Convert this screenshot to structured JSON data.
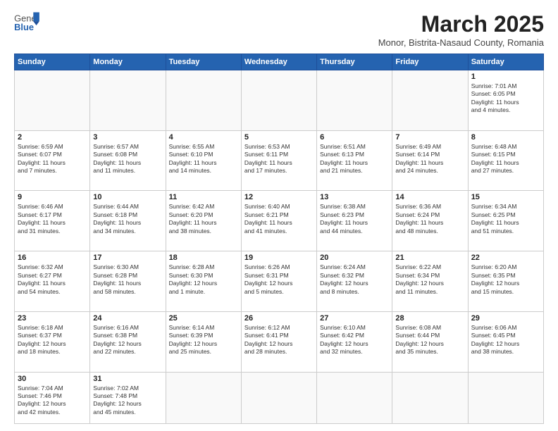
{
  "header": {
    "logo_general": "General",
    "logo_blue": "Blue",
    "month_title": "March 2025",
    "subtitle": "Monor, Bistrita-Nasaud County, Romania"
  },
  "weekdays": [
    "Sunday",
    "Monday",
    "Tuesday",
    "Wednesday",
    "Thursday",
    "Friday",
    "Saturday"
  ],
  "weeks": [
    [
      {
        "day": "",
        "info": ""
      },
      {
        "day": "",
        "info": ""
      },
      {
        "day": "",
        "info": ""
      },
      {
        "day": "",
        "info": ""
      },
      {
        "day": "",
        "info": ""
      },
      {
        "day": "",
        "info": ""
      },
      {
        "day": "1",
        "info": "Sunrise: 7:01 AM\nSunset: 6:05 PM\nDaylight: 11 hours\nand 4 minutes."
      }
    ],
    [
      {
        "day": "2",
        "info": "Sunrise: 6:59 AM\nSunset: 6:07 PM\nDaylight: 11 hours\nand 7 minutes."
      },
      {
        "day": "3",
        "info": "Sunrise: 6:57 AM\nSunset: 6:08 PM\nDaylight: 11 hours\nand 11 minutes."
      },
      {
        "day": "4",
        "info": "Sunrise: 6:55 AM\nSunset: 6:10 PM\nDaylight: 11 hours\nand 14 minutes."
      },
      {
        "day": "5",
        "info": "Sunrise: 6:53 AM\nSunset: 6:11 PM\nDaylight: 11 hours\nand 17 minutes."
      },
      {
        "day": "6",
        "info": "Sunrise: 6:51 AM\nSunset: 6:13 PM\nDaylight: 11 hours\nand 21 minutes."
      },
      {
        "day": "7",
        "info": "Sunrise: 6:49 AM\nSunset: 6:14 PM\nDaylight: 11 hours\nand 24 minutes."
      },
      {
        "day": "8",
        "info": "Sunrise: 6:48 AM\nSunset: 6:15 PM\nDaylight: 11 hours\nand 27 minutes."
      }
    ],
    [
      {
        "day": "9",
        "info": "Sunrise: 6:46 AM\nSunset: 6:17 PM\nDaylight: 11 hours\nand 31 minutes."
      },
      {
        "day": "10",
        "info": "Sunrise: 6:44 AM\nSunset: 6:18 PM\nDaylight: 11 hours\nand 34 minutes."
      },
      {
        "day": "11",
        "info": "Sunrise: 6:42 AM\nSunset: 6:20 PM\nDaylight: 11 hours\nand 38 minutes."
      },
      {
        "day": "12",
        "info": "Sunrise: 6:40 AM\nSunset: 6:21 PM\nDaylight: 11 hours\nand 41 minutes."
      },
      {
        "day": "13",
        "info": "Sunrise: 6:38 AM\nSunset: 6:23 PM\nDaylight: 11 hours\nand 44 minutes."
      },
      {
        "day": "14",
        "info": "Sunrise: 6:36 AM\nSunset: 6:24 PM\nDaylight: 11 hours\nand 48 minutes."
      },
      {
        "day": "15",
        "info": "Sunrise: 6:34 AM\nSunset: 6:25 PM\nDaylight: 11 hours\nand 51 minutes."
      }
    ],
    [
      {
        "day": "16",
        "info": "Sunrise: 6:32 AM\nSunset: 6:27 PM\nDaylight: 11 hours\nand 54 minutes."
      },
      {
        "day": "17",
        "info": "Sunrise: 6:30 AM\nSunset: 6:28 PM\nDaylight: 11 hours\nand 58 minutes."
      },
      {
        "day": "18",
        "info": "Sunrise: 6:28 AM\nSunset: 6:30 PM\nDaylight: 12 hours\nand 1 minute."
      },
      {
        "day": "19",
        "info": "Sunrise: 6:26 AM\nSunset: 6:31 PM\nDaylight: 12 hours\nand 5 minutes."
      },
      {
        "day": "20",
        "info": "Sunrise: 6:24 AM\nSunset: 6:32 PM\nDaylight: 12 hours\nand 8 minutes."
      },
      {
        "day": "21",
        "info": "Sunrise: 6:22 AM\nSunset: 6:34 PM\nDaylight: 12 hours\nand 11 minutes."
      },
      {
        "day": "22",
        "info": "Sunrise: 6:20 AM\nSunset: 6:35 PM\nDaylight: 12 hours\nand 15 minutes."
      }
    ],
    [
      {
        "day": "23",
        "info": "Sunrise: 6:18 AM\nSunset: 6:37 PM\nDaylight: 12 hours\nand 18 minutes."
      },
      {
        "day": "24",
        "info": "Sunrise: 6:16 AM\nSunset: 6:38 PM\nDaylight: 12 hours\nand 22 minutes."
      },
      {
        "day": "25",
        "info": "Sunrise: 6:14 AM\nSunset: 6:39 PM\nDaylight: 12 hours\nand 25 minutes."
      },
      {
        "day": "26",
        "info": "Sunrise: 6:12 AM\nSunset: 6:41 PM\nDaylight: 12 hours\nand 28 minutes."
      },
      {
        "day": "27",
        "info": "Sunrise: 6:10 AM\nSunset: 6:42 PM\nDaylight: 12 hours\nand 32 minutes."
      },
      {
        "day": "28",
        "info": "Sunrise: 6:08 AM\nSunset: 6:44 PM\nDaylight: 12 hours\nand 35 minutes."
      },
      {
        "day": "29",
        "info": "Sunrise: 6:06 AM\nSunset: 6:45 PM\nDaylight: 12 hours\nand 38 minutes."
      }
    ],
    [
      {
        "day": "30",
        "info": "Sunrise: 7:04 AM\nSunset: 7:46 PM\nDaylight: 12 hours\nand 42 minutes."
      },
      {
        "day": "31",
        "info": "Sunrise: 7:02 AM\nSunset: 7:48 PM\nDaylight: 12 hours\nand 45 minutes."
      },
      {
        "day": "",
        "info": ""
      },
      {
        "day": "",
        "info": ""
      },
      {
        "day": "",
        "info": ""
      },
      {
        "day": "",
        "info": ""
      },
      {
        "day": "",
        "info": ""
      }
    ]
  ]
}
